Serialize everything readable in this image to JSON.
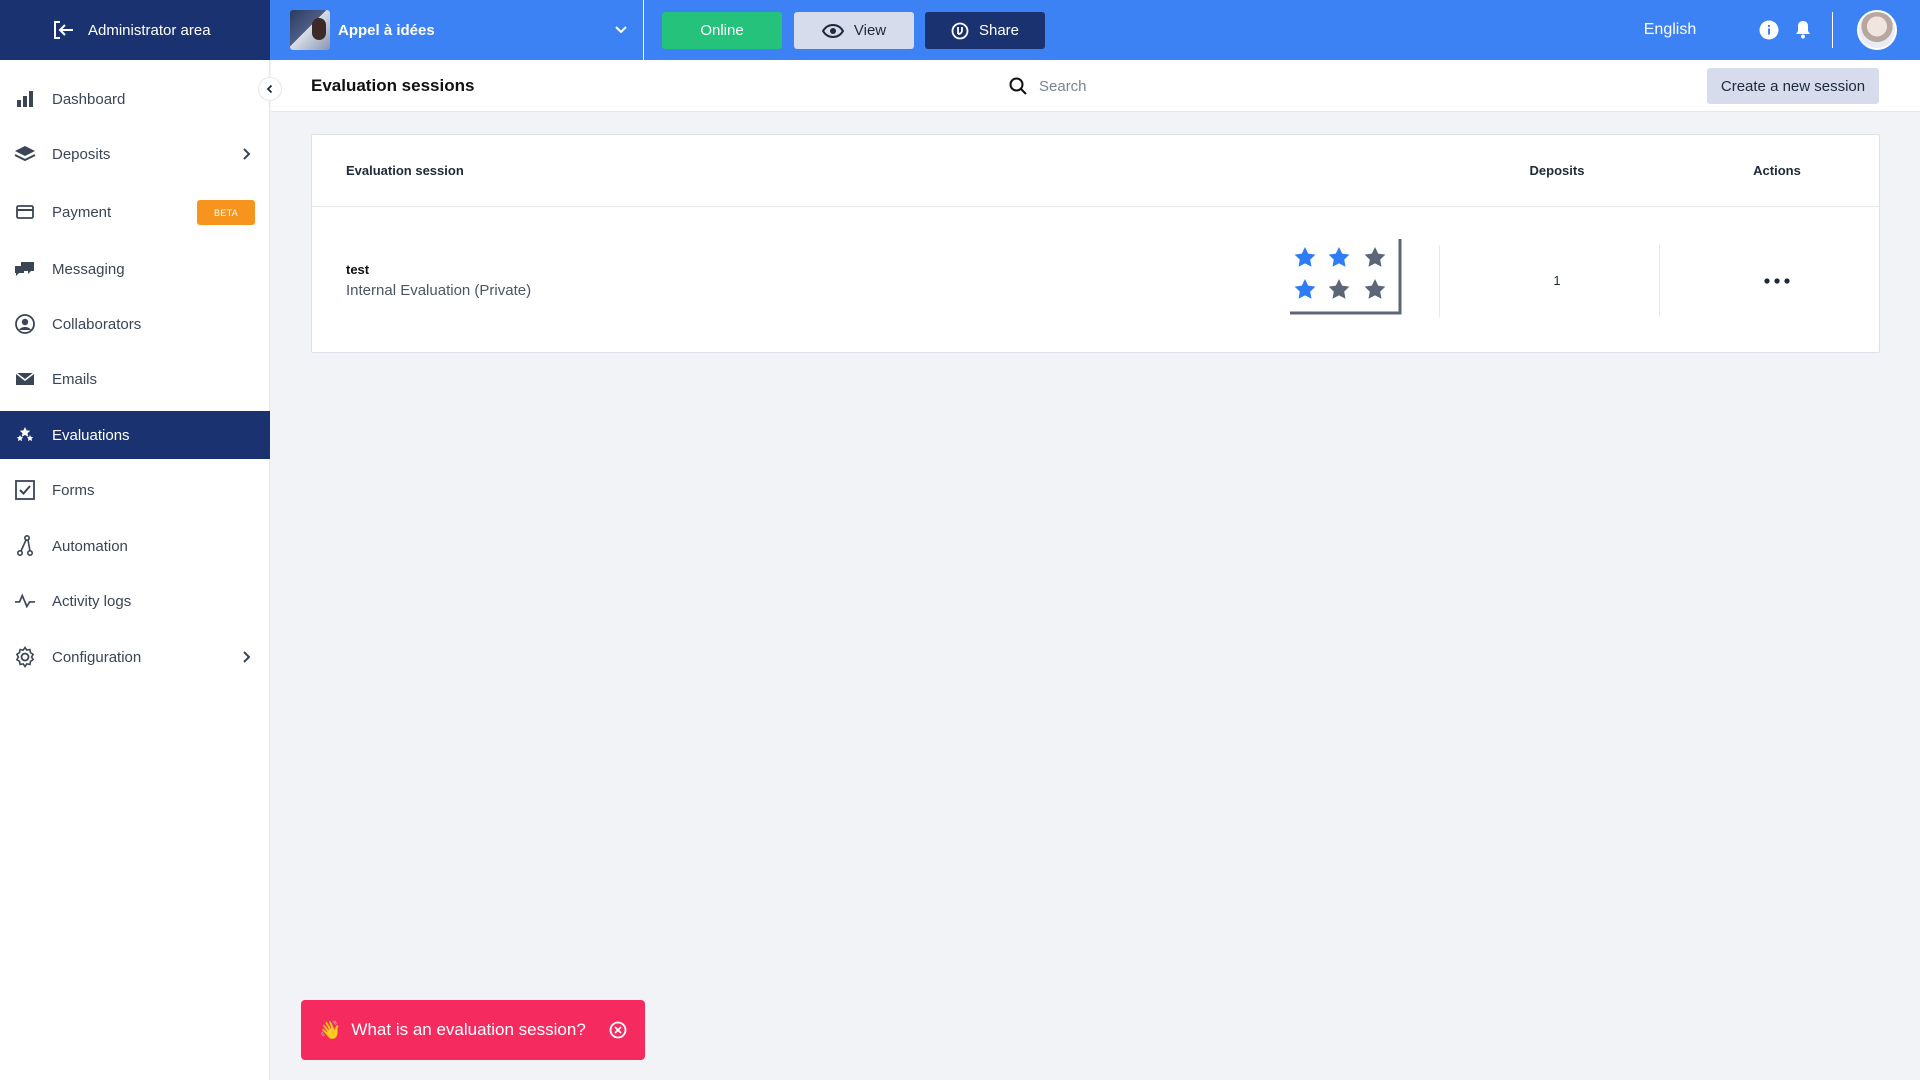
{
  "topbar": {
    "admin_label": "Administrator area",
    "project_name": "Appel à idées",
    "online_label": "Online",
    "view_label": "View",
    "share_label": "Share",
    "language": "English"
  },
  "sidebar": {
    "items": [
      {
        "label": "Dashboard",
        "icon": "bar-chart-icon"
      },
      {
        "label": "Deposits",
        "icon": "layers-icon"
      },
      {
        "label": "Payment",
        "icon": "credit-card-icon",
        "badge": "BETA"
      },
      {
        "label": "Messaging",
        "icon": "chat-icon"
      },
      {
        "label": "Collaborators",
        "icon": "user-circle-icon"
      },
      {
        "label": "Emails",
        "icon": "envelope-icon"
      },
      {
        "label": "Evaluations",
        "icon": "stars-icon"
      },
      {
        "label": "Forms",
        "icon": "checkbox-icon"
      },
      {
        "label": "Automation",
        "icon": "workflow-icon"
      },
      {
        "label": "Activity logs",
        "icon": "pulse-icon"
      },
      {
        "label": "Configuration",
        "icon": "gear-icon"
      }
    ]
  },
  "header": {
    "title": "Evaluation sessions",
    "search_placeholder": "Search",
    "create_label": "Create a new session"
  },
  "table": {
    "columns": [
      "Evaluation session",
      "Deposits",
      "Actions"
    ],
    "rows": [
      {
        "name": "test",
        "type": "Internal Evaluation (Private)",
        "deposits": "1"
      }
    ]
  },
  "help": {
    "text": "What is an evaluation session?"
  },
  "colors": {
    "topbar": "#3d82f5",
    "navy": "#1a3270",
    "online": "#24c27a",
    "beta": "#f7941d",
    "help": "#f52a5f"
  }
}
